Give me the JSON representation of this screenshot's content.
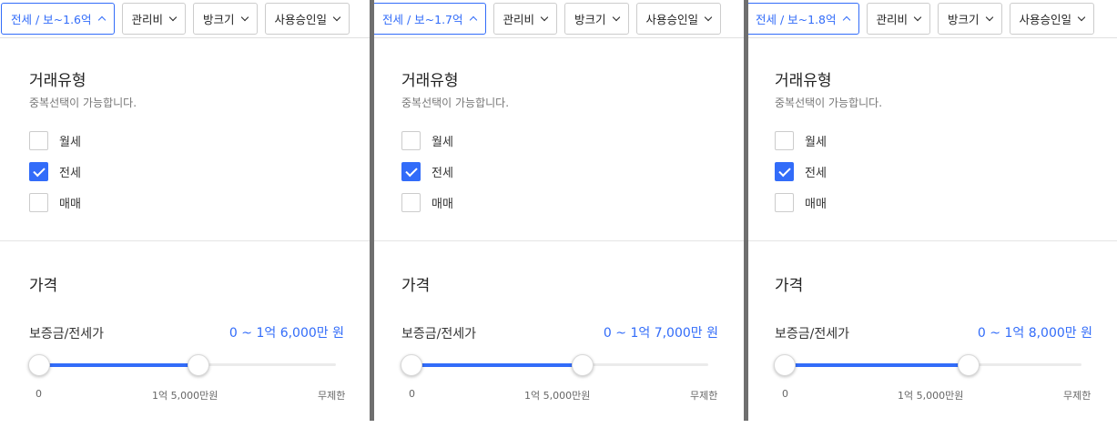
{
  "panels": [
    {
      "filters": {
        "trade": "전세 / 보~1.6억",
        "fee": "관리비",
        "room_size": "방크기",
        "approval_date": "사용승인일"
      },
      "trade_type": {
        "title": "거래유형",
        "subtitle": "중복선택이 가능합니다.",
        "options": [
          {
            "label": "월세",
            "checked": false
          },
          {
            "label": "전세",
            "checked": true
          },
          {
            "label": "매매",
            "checked": false
          }
        ]
      },
      "price": {
        "title": "가격",
        "label": "보증금/전세가",
        "value": "0 ~ 1억 6,000만 원",
        "slider": {
          "min_label": "0",
          "mid_label": "1억 5,000만원",
          "max_label": "무제한",
          "low": 0,
          "high": 0.54
        }
      }
    },
    {
      "filters": {
        "trade": "전세 / 보~1.7억",
        "fee": "관리비",
        "room_size": "방크기",
        "approval_date": "사용승인일"
      },
      "trade_type": {
        "title": "거래유형",
        "subtitle": "중복선택이 가능합니다.",
        "options": [
          {
            "label": "월세",
            "checked": false
          },
          {
            "label": "전세",
            "checked": true
          },
          {
            "label": "매매",
            "checked": false
          }
        ]
      },
      "price": {
        "title": "가격",
        "label": "보증금/전세가",
        "value": "0 ~ 1억 7,000만 원",
        "slider": {
          "min_label": "0",
          "mid_label": "1억 5,000만원",
          "max_label": "무제한",
          "low": 0,
          "high": 0.57
        }
      }
    },
    {
      "filters": {
        "trade": "전세 / 보~1.8억",
        "fee": "관리비",
        "room_size": "방크기",
        "approval_date": "사용승인일"
      },
      "trade_type": {
        "title": "거래유형",
        "subtitle": "중복선택이 가능합니다.",
        "options": [
          {
            "label": "월세",
            "checked": false
          },
          {
            "label": "전세",
            "checked": true
          },
          {
            "label": "매매",
            "checked": false
          }
        ]
      },
      "price": {
        "title": "가격",
        "label": "보증금/전세가",
        "value": "0 ~ 1억 8,000만 원",
        "slider": {
          "min_label": "0",
          "mid_label": "1억 5,000만원",
          "max_label": "무제한",
          "low": 0,
          "high": 0.6
        }
      }
    }
  ],
  "colors": {
    "accent": "#326cf9",
    "divider": "#6f6f6f"
  }
}
